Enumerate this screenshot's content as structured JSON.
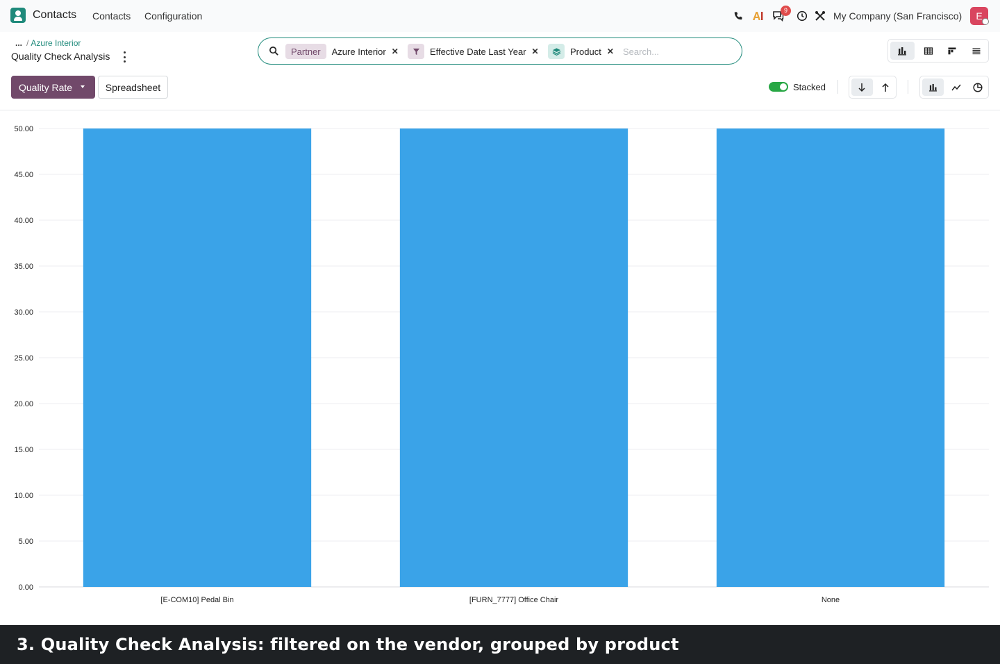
{
  "navbar": {
    "app_name": "Contacts",
    "menu": [
      "Contacts",
      "Configuration"
    ],
    "messages_badge": "9",
    "company": "My Company (San Francisco)",
    "avatar_initial": "E"
  },
  "breadcrumb": {
    "ellipsis": "...",
    "separator": "/",
    "parent": "Azure Interior"
  },
  "page_title": "Quality Check Analysis",
  "search": {
    "placeholder": "Search...",
    "facets": [
      {
        "tag": "Partner",
        "value": "Azure Interior",
        "icon": "none"
      },
      {
        "tag_icon": "filter-icon",
        "value": "Effective Date Last Year"
      },
      {
        "tag_icon": "layers-icon",
        "value": "Product"
      }
    ]
  },
  "toolbar": {
    "measure_label": "Quality Rate",
    "spreadsheet_label": "Spreadsheet",
    "stacked_label": "Stacked",
    "stacked_on": true
  },
  "colors": {
    "brand": "#71496a",
    "accent": "#1f8a7b",
    "bar": "#3aa3e8",
    "toggle_on": "#28a745"
  },
  "chart_data": {
    "type": "bar",
    "categories": [
      "[E-COM10] Pedal Bin",
      "[FURN_7777] Office Chair",
      "None"
    ],
    "values": [
      50,
      50,
      50
    ],
    "ylim": [
      0,
      50
    ],
    "yticks": [
      "0.00",
      "5.00",
      "10.00",
      "15.00",
      "20.00",
      "25.00",
      "30.00",
      "35.00",
      "40.00",
      "45.00",
      "50.00"
    ],
    "grid": true
  },
  "caption": "3. Quality Check Analysis: filtered on the vendor, grouped by product"
}
